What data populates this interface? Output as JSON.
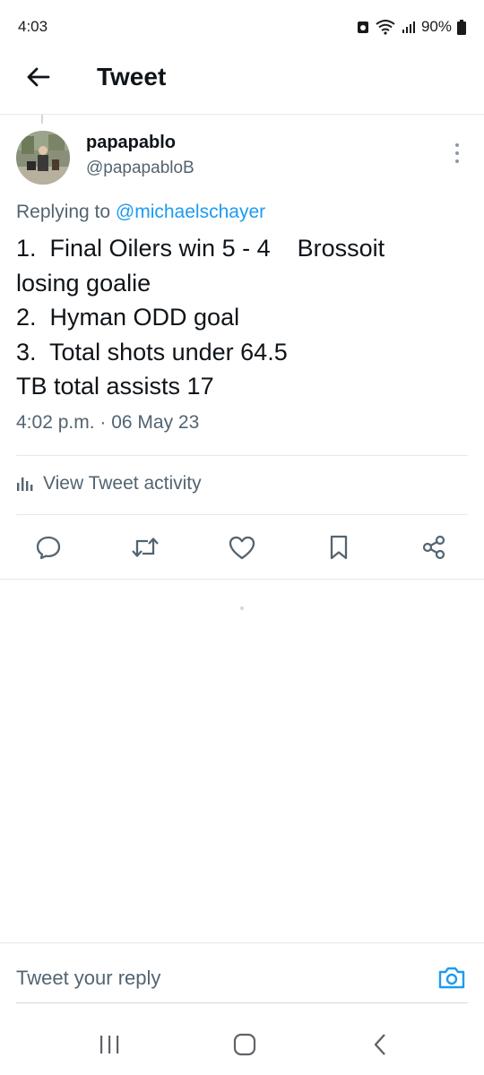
{
  "status_bar": {
    "time": "4:03",
    "battery": "90%"
  },
  "header": {
    "title": "Tweet"
  },
  "tweet": {
    "display_name": "papapablo",
    "handle": "@papapabloB",
    "replying_prefix": "Replying to ",
    "replying_to": "@michaelschayer",
    "text_lines": [
      "1.  Final Oilers win 5 - 4    Brossoit",
      "losing goalie",
      "2.  Hyman ODD goal",
      "3.  Total shots under 64.5",
      "TB total assists 17"
    ],
    "timestamp": "4:02 p.m. · 06 May 23",
    "activity_label": "View Tweet activity",
    "actions": [
      "reply-icon",
      "retweet-icon",
      "like-icon",
      "bookmark-icon",
      "share-icon"
    ]
  },
  "reply_bar": {
    "placeholder": "Tweet your reply"
  },
  "colors": {
    "accent": "#1d9bf0",
    "secondary_text": "#536471",
    "primary_text": "#0f1419"
  }
}
